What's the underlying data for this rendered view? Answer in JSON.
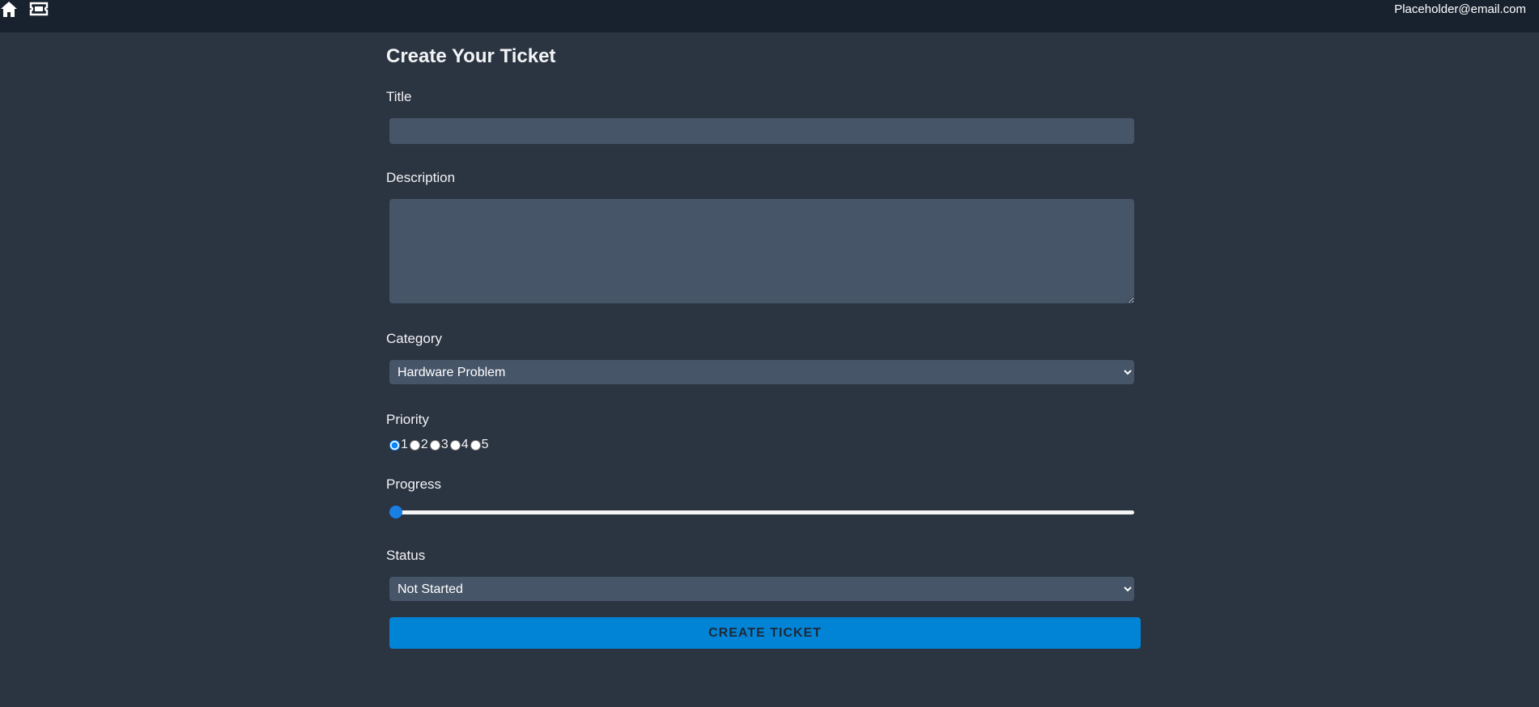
{
  "header": {
    "home_icon": "home-icon",
    "ticket_icon": "ticket-icon",
    "user_email": "Placeholder@email.com"
  },
  "form": {
    "heading": "Create Your Ticket",
    "title_label": "Title",
    "title_value": "",
    "description_label": "Description",
    "description_value": "",
    "category_label": "Category",
    "category_selected": "Hardware Problem",
    "priority_label": "Priority",
    "priority_options": [
      "1",
      "2",
      "3",
      "4",
      "5"
    ],
    "priority_selected": "1",
    "progress_label": "Progress",
    "progress_value": 0,
    "status_label": "Status",
    "status_selected": "Not Started",
    "submit_label": "CREATE TICKET"
  },
  "colors": {
    "background": "#2b3441",
    "topbar": "#18222f",
    "input_bg": "#475569",
    "accent": "#0284d6"
  }
}
